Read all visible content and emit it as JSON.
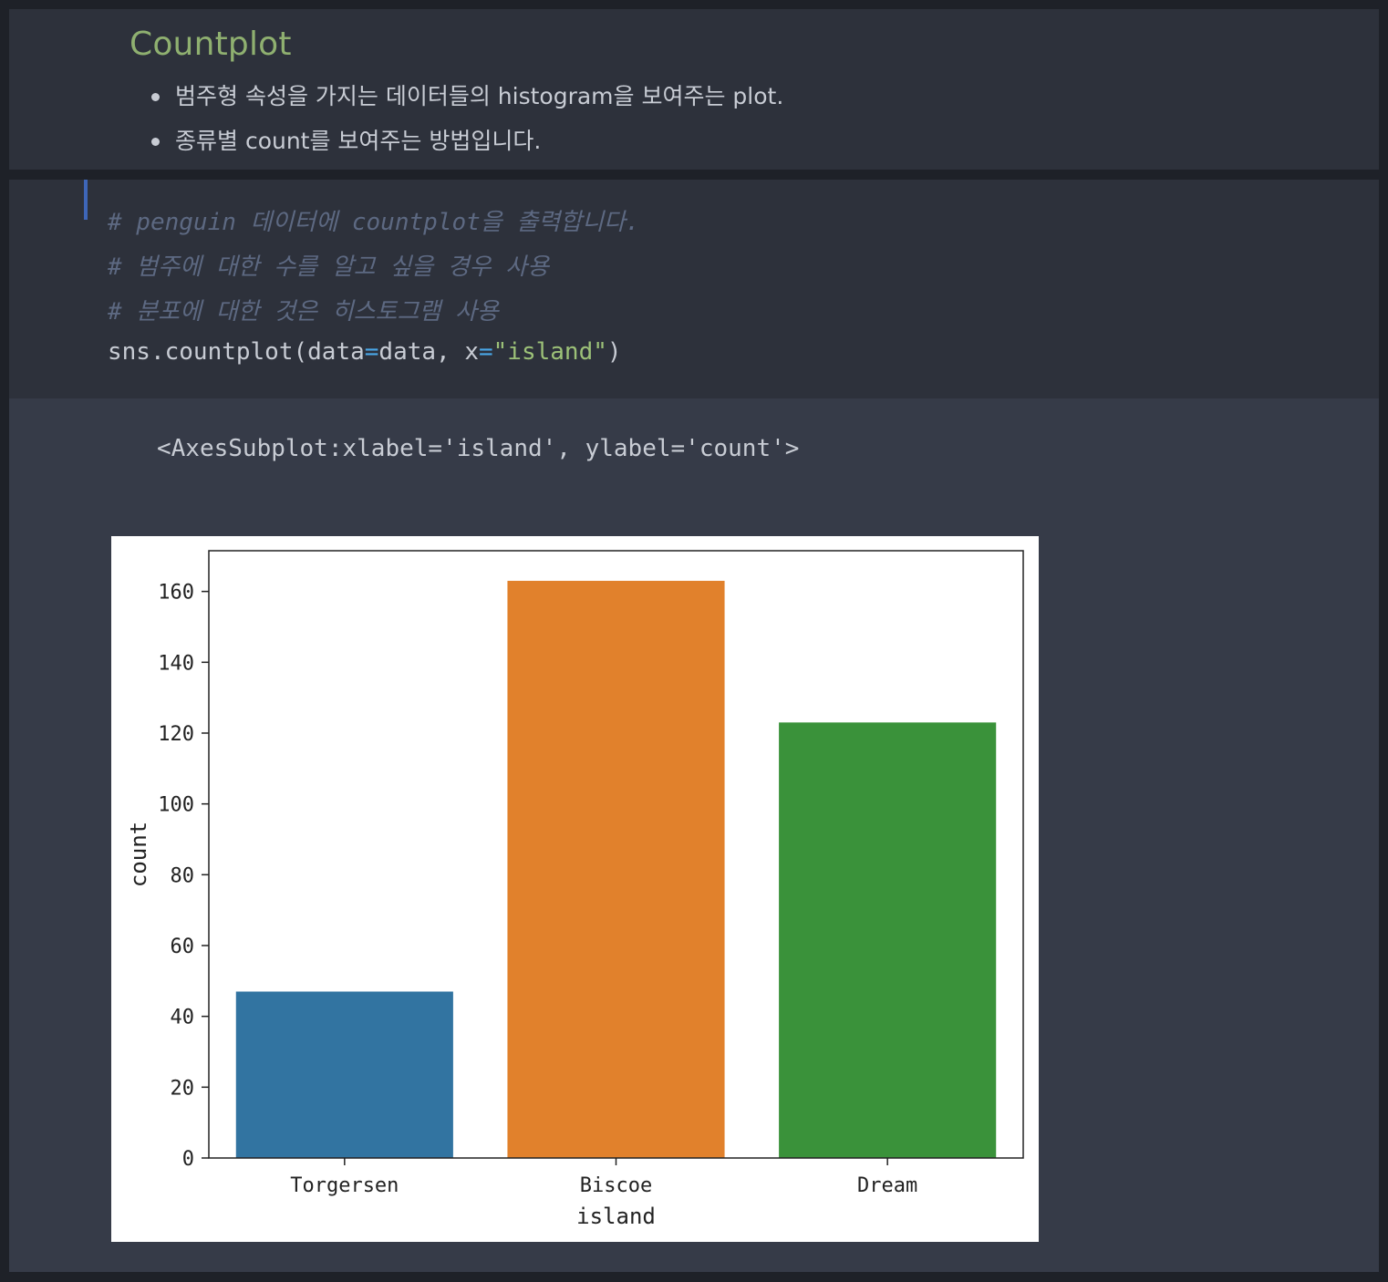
{
  "markdown": {
    "title": "Countplot",
    "bullets": [
      "범주형 속성을 가지는 데이터들의 histogram을 보여주는 plot.",
      "종류별 count를 보여주는 방법입니다."
    ]
  },
  "code": {
    "comments": [
      "# penguin 데이터에 countplot을 출력합니다.",
      "# 범주에 대한 수를 알고 싶을 경우 사용",
      "# 분포에 대한 것은 히스토그램 사용"
    ],
    "call_prefix": "sns.countplot(data",
    "eq1": "=",
    "call_mid": "data, x",
    "eq2": "=",
    "string_arg": "\"island\"",
    "call_suffix": ")"
  },
  "output": {
    "repr": "<AxesSubplot:xlabel='island', ylabel='count'>"
  },
  "chart_data": {
    "type": "bar",
    "categories": [
      "Torgersen",
      "Biscoe",
      "Dream"
    ],
    "values": [
      47,
      163,
      123
    ],
    "colors": [
      "#3274a1",
      "#e1812c",
      "#3a923a"
    ],
    "xlabel": "island",
    "ylabel": "count",
    "ylim": [
      0,
      171.5
    ],
    "yticks": [
      0,
      20,
      40,
      60,
      80,
      100,
      120,
      140,
      160
    ],
    "grid": false
  }
}
